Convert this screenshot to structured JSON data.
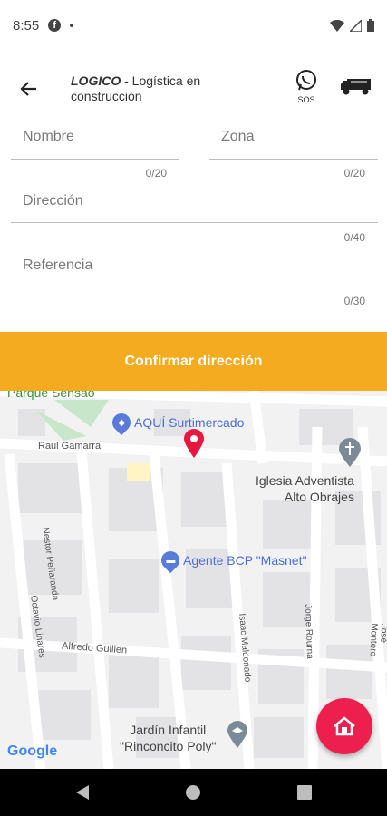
{
  "status_bar": {
    "time": "8:55",
    "fb_glyph": "f"
  },
  "app_bar": {
    "title_brand": "LOGICO",
    "title_rest": " - Logística en construcción",
    "sos_label": "SOS"
  },
  "form": {
    "nombre_placeholder": "Nombre",
    "nombre_counter": "0/20",
    "zona_placeholder": "Zona",
    "zona_counter": "0/20",
    "direccion_placeholder": "Dirección",
    "direccion_counter": "0/40",
    "referencia_placeholder": "Referencia",
    "referencia_counter": "0/30"
  },
  "confirm_label": "Confirmar dirección",
  "map": {
    "park": "Parque Sensao",
    "market": "AQUÍ Surtimercado",
    "street_raul": "Raul Gamarra",
    "church": "Iglesia Adventista Alto Obrajes",
    "church_line1": "Iglesia Adventista",
    "church_line2": "Alto Obrajes",
    "bcp": "Agente BCP \"Masnet\"",
    "street_nestor": "Nestor Peñaranda",
    "street_octavio": "Octavio Linares",
    "street_alfredo": "Alfredo Guillen",
    "street_isaac": "Isaac Maldonado",
    "street_jorge": "Jorge Rourna",
    "street_jose": "José Montero",
    "jardin_line1": "Jardín Infantil",
    "jardin_line2": "\"Rinconcito Poly\"",
    "google": "Google"
  },
  "colors": {
    "accent": "#f5ab1f",
    "fab": "#ec1f4f",
    "marker": "#e8173f"
  },
  "icons": [
    "back-arrow-icon",
    "whatsapp-icon",
    "truck-icon",
    "map-marker-icon",
    "home-icon"
  ]
}
